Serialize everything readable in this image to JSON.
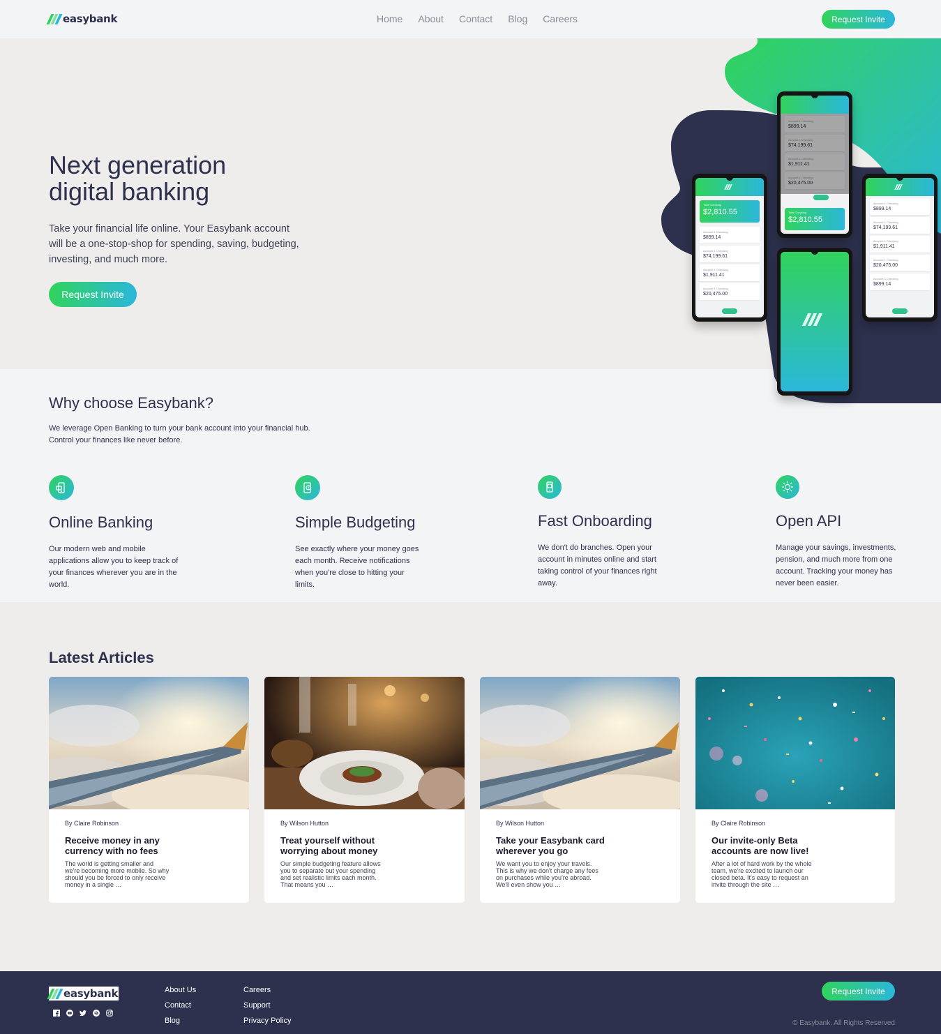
{
  "brand": {
    "name": "easybank",
    "colors": {
      "dark_blue": "#2d314d",
      "lime_green": "#31d35c",
      "bright_cyan": "#2bb7da",
      "grayish_blue": "#8a8c99",
      "light_gray": "#f3f4f6"
    }
  },
  "header": {
    "nav": [
      "Home",
      "About",
      "Contact",
      "Blog",
      "Careers"
    ],
    "cta": "Request Invite"
  },
  "hero": {
    "title_line1": "Next generation",
    "title_line2": "digital banking",
    "text": "Take your financial life online. Your Easybank account will be a one-stop-shop for spending, saving, budgeting, investing, and much more.",
    "cta": "Request Invite"
  },
  "phones": {
    "total_label": "Total Checking",
    "total_amount": "$2,810.55",
    "account_label": "Account 1 Checking",
    "accounts": [
      "$899.14",
      "$74,199.61",
      "$1,911.41",
      "$20,475.00"
    ]
  },
  "why": {
    "title": "Why choose Easybank?",
    "text": "We leverage Open Banking to turn your bank account into your financial hub. Control your finances like never before.",
    "features": [
      {
        "icon": "online-banking-icon",
        "title": "Online Banking",
        "text": "Our modern web and mobile applications allow you to keep track of your finances wherever you are in the world."
      },
      {
        "icon": "budgeting-icon",
        "title": "Simple Budgeting",
        "text": "See exactly where your money goes each month. Receive notifications when you're close to hitting your limits."
      },
      {
        "icon": "onboarding-icon",
        "title": "Fast Onboarding",
        "text": "We don't do branches. Open your account in minutes online and start taking control of your finances right away."
      },
      {
        "icon": "api-icon",
        "title": "Open API",
        "text": "Manage your savings, investments, pension, and much more from one account. Tracking your money has never been easier."
      }
    ]
  },
  "articles": {
    "title": "Latest Articles",
    "items": [
      {
        "author": "By Claire Robinson",
        "title": "Receive money in any currency with no fees",
        "excerpt": "The world is getting smaller and we're becoming more mobile. So why should you be forced to only receive money in a single …",
        "image": "airplane-wing-image"
      },
      {
        "author": "By Wilson Hutton",
        "title": "Treat yourself without worrying about money",
        "excerpt": "Our simple budgeting feature allows you to separate out your spending and set realistic limits each month. That means you …",
        "image": "restaurant-dinner-image"
      },
      {
        "author": "By Wilson Hutton",
        "title": "Take your Easybank card wherever you go",
        "excerpt": "We want you to enjoy your travels. This is why we don't charge any fees on purchases while you're abroad. We'll even show you …",
        "image": "airplane-wing-image"
      },
      {
        "author": "By Claire Robinson",
        "title": "Our invite-only Beta accounts are now live!",
        "excerpt": "After a lot of hard work by the whole team, we're excited to launch our closed beta. It's easy to request an invite through the site …",
        "image": "confetti-image"
      }
    ]
  },
  "footer": {
    "links_col1": [
      "About Us",
      "Contact",
      "Blog"
    ],
    "links_col2": [
      "Careers",
      "Support",
      "Privacy Policy"
    ],
    "socials": [
      "facebook-icon",
      "youtube-icon",
      "twitter-icon",
      "pinterest-icon",
      "instagram-icon"
    ],
    "cta": "Request Invite",
    "copyright": "© Easybank. All Rights Reserved"
  }
}
